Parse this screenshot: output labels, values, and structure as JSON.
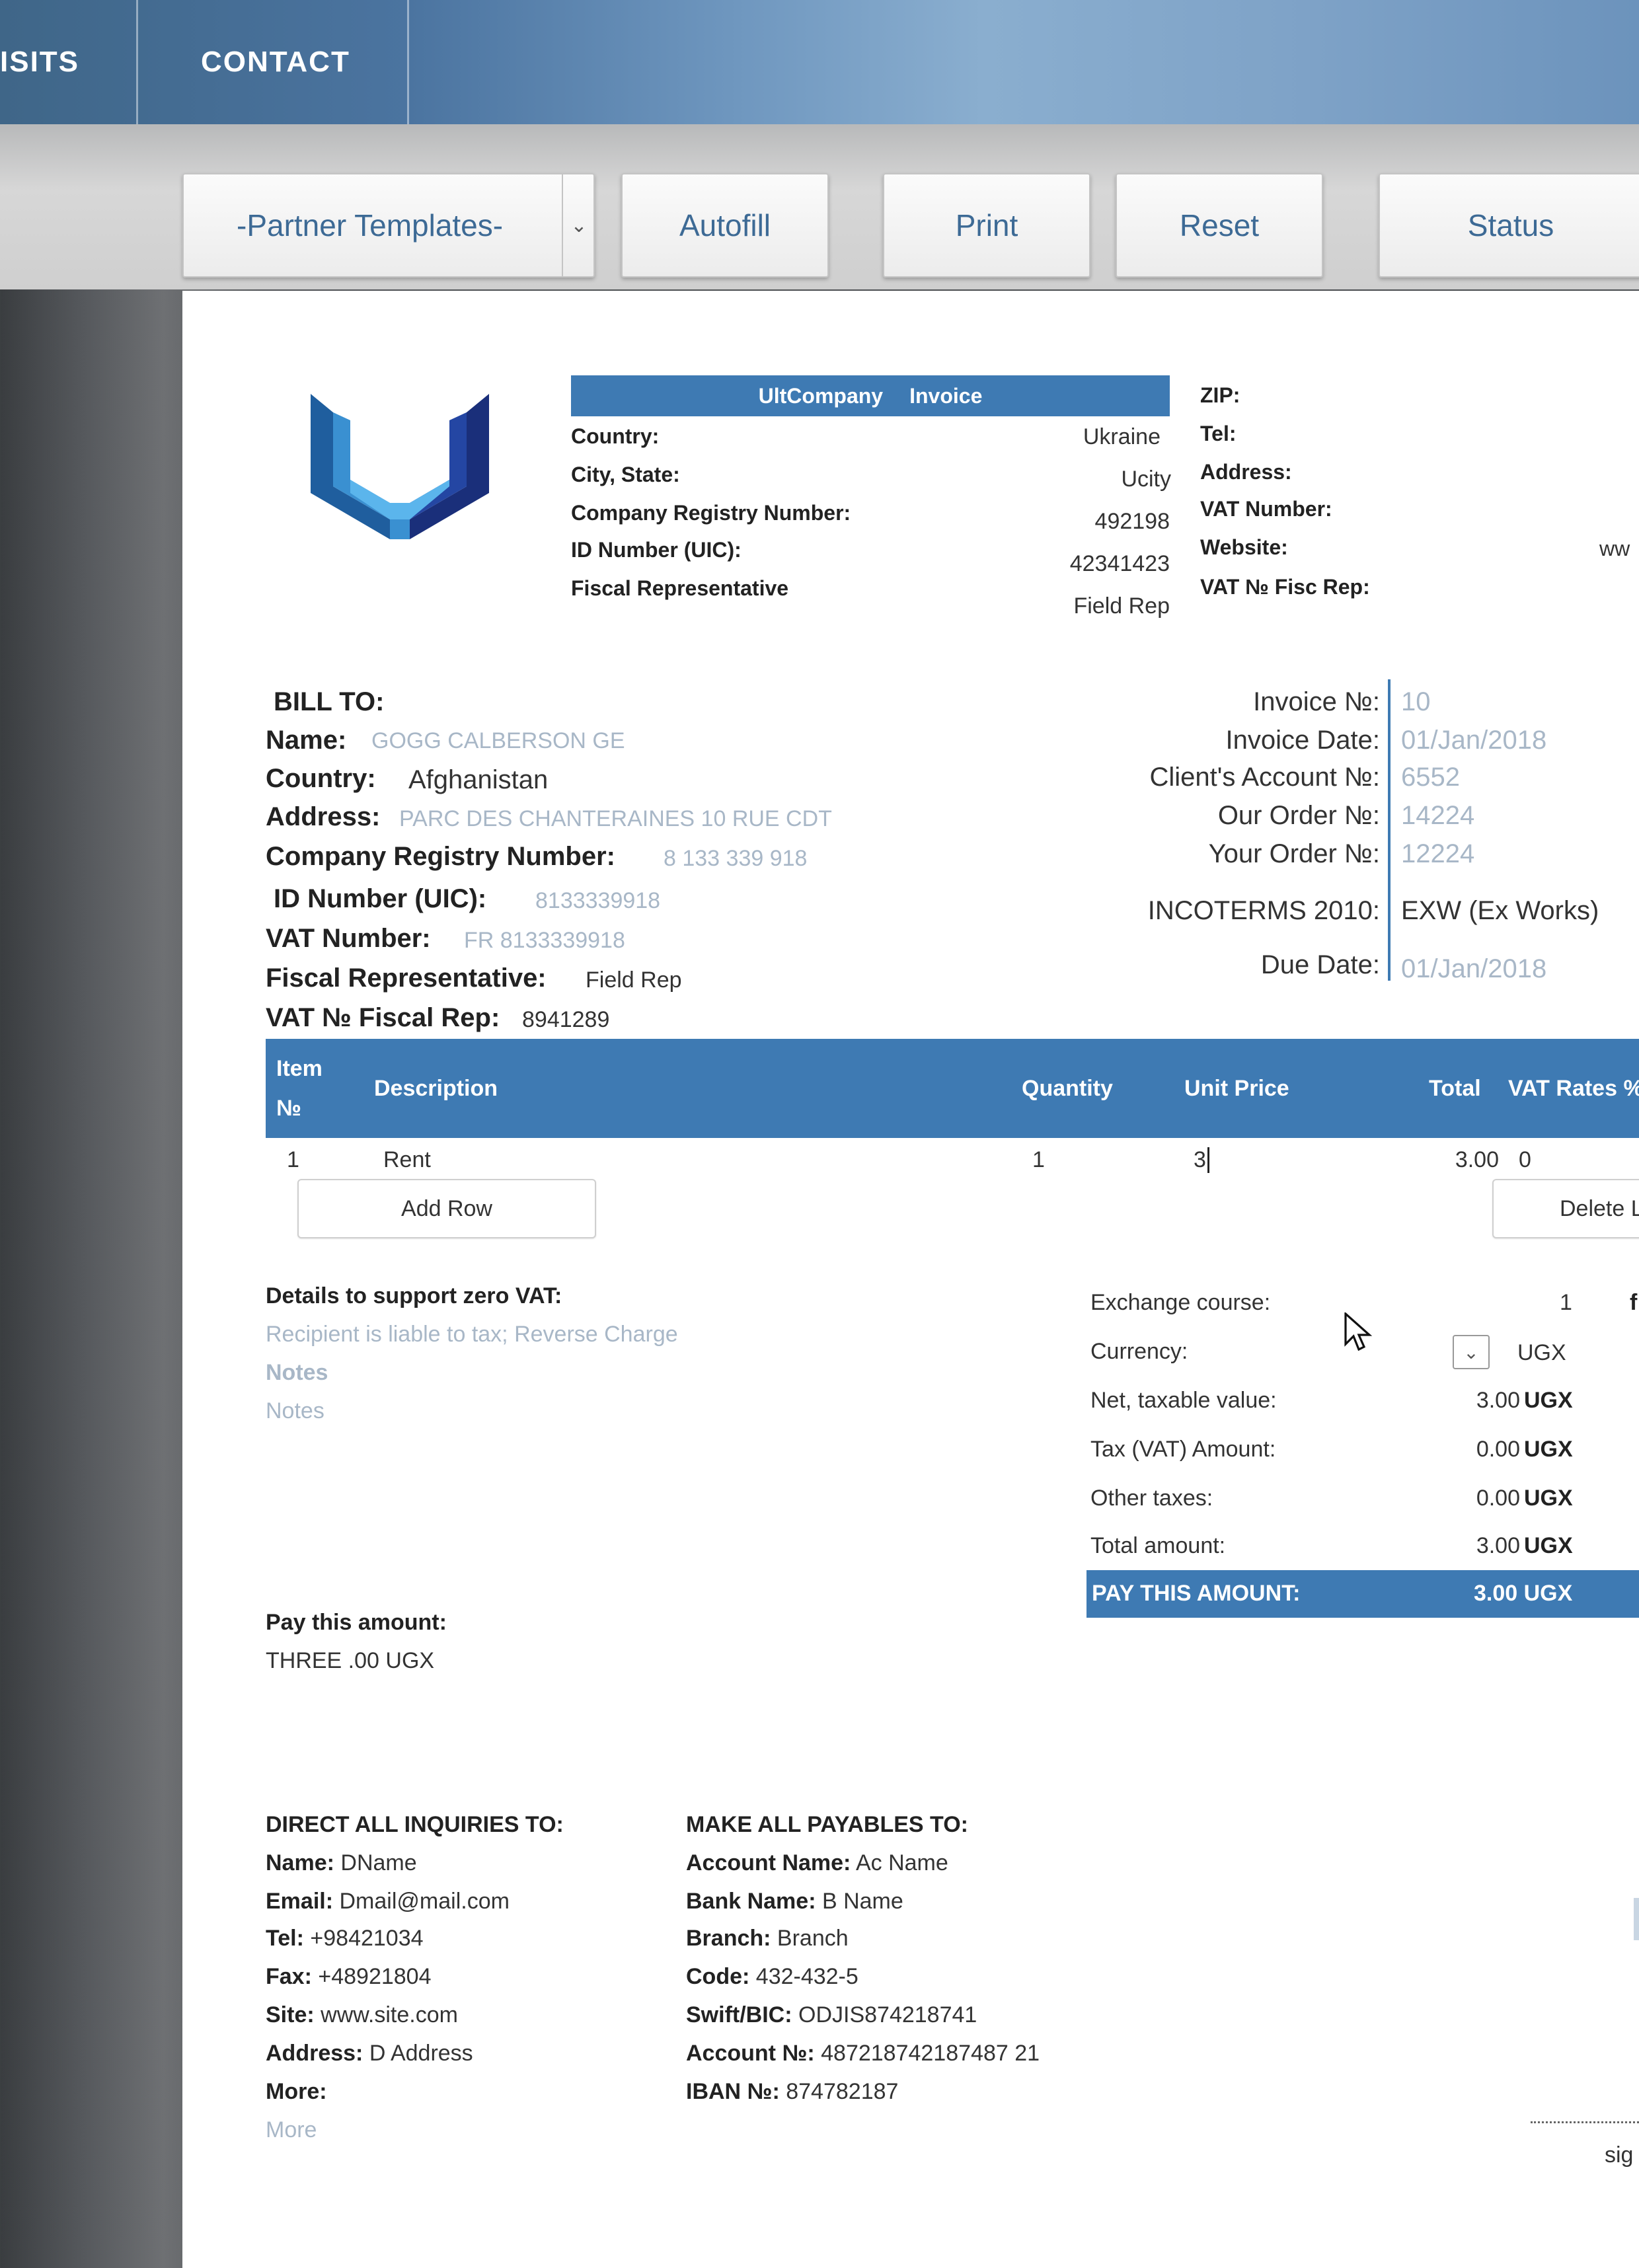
{
  "nav": {
    "items": [
      "ISITS",
      "CONTACT"
    ]
  },
  "toolbar": {
    "template_select": "-Partner Templates-",
    "autofill": "Autofill",
    "print": "Print",
    "reset": "Reset",
    "status": "Status"
  },
  "company": {
    "header_name": "UltCompany",
    "header_doc": "Invoice",
    "country_label": "Country:",
    "country": "Ukraine",
    "city_label": "City, State:",
    "city": "Ucity",
    "reg_label": "Company Registry Number:",
    "reg": "492198",
    "id_label": "ID Number (UIC):",
    "id": "42341423",
    "fiscal_label": "Fiscal Representative",
    "fiscal": "Field Rep",
    "zip_label": "ZIP:",
    "tel_label": "Tel:",
    "address_label": "Address:",
    "vat_label": "VAT Number:",
    "website_label": "Website:",
    "website": "ww",
    "vatfisc_label": "VAT № Fisc Rep:"
  },
  "billto": {
    "title": "BILL TO:",
    "name_label": "Name:",
    "name": "GOGG CALBERSON GE",
    "country_label": "Country:",
    "country": "Afghanistan",
    "address_label": "Address:",
    "address": "PARC DES CHANTERAINES 10 RUE CDT",
    "reg_label": "Company Registry Number:",
    "reg": "8 133 339 918",
    "id_label": "ID Number (UIC):",
    "id": "8133339918",
    "vat_label": "VAT Number:",
    "vat": "FR 8133339918",
    "fiscal_label": "Fiscal Representative:",
    "fiscal": "Field Rep",
    "vatfisc_label": "VAT № Fiscal Rep:",
    "vatfisc": "8941289"
  },
  "invoice": {
    "no_label": "Invoice №:",
    "no": "10",
    "date_label": "Invoice Date:",
    "date": "01/Jan/2018",
    "account_label": "Client's Account №:",
    "account": "6552",
    "our_order_label": "Our Order №:",
    "our_order": "14224",
    "your_order_label": "Your Order №:",
    "your_order": "12224",
    "incoterms_label": "INCOTERMS 2010:",
    "incoterms": "EXW (Ex Works)",
    "due_label": "Due Date:",
    "due": "01/Jan/2018"
  },
  "table": {
    "headers": {
      "item_1": "Item",
      "item_2": "№",
      "description": "Description",
      "quantity": "Quantity",
      "unit_price": "Unit Price",
      "total": "Total",
      "vat": "VAT Rates %"
    },
    "rows": [
      {
        "item": "1",
        "description": "Rent",
        "quantity": "1",
        "unit_price": "3",
        "total": "3.00",
        "vat": "0"
      }
    ],
    "add_row": "Add Row",
    "delete": "Delete L"
  },
  "zero_vat": {
    "title": "Details to support zero VAT:",
    "text": "Recipient is liable to tax; Reverse Charge",
    "notes_label": "Notes",
    "notes": "Notes"
  },
  "totals": {
    "exchange_label": "Exchange course:",
    "exchange": "1",
    "exchange_extra": "f",
    "currency_label": "Currency:",
    "currency": "UGX",
    "net_label": "Net, taxable value:",
    "net": "3.00",
    "net_cur": "UGX",
    "tax_label": "Tax (VAT) Amount:",
    "tax": "0.00",
    "tax_cur": "UGX",
    "other_label": "Other taxes:",
    "other": "0.00",
    "other_cur": "UGX",
    "total_label": "Total amount:",
    "total": "3.00",
    "total_cur": "UGX",
    "pay_label": "PAY THIS AMOUNT:",
    "pay": "3.00 UGX"
  },
  "pay_words": {
    "label": "Pay this amount:",
    "value": "THREE .00 UGX"
  },
  "inquiries": {
    "title": "DIRECT ALL INQUIRIES TO:",
    "name_label": "Name:",
    "name": "DName",
    "email_label": "Email:",
    "email": "Dmail@mail.com",
    "tel_label": "Tel:",
    "tel": "+98421034",
    "fax_label": "Fax:",
    "fax": "+48921804",
    "site_label": "Site:",
    "site": "www.site.com",
    "address_label": "Address:",
    "address": "D Address",
    "more_label": "More:",
    "more": "More"
  },
  "payables": {
    "title": "MAKE ALL PAYABLES TO:",
    "account_name_label": "Account Name:",
    "account_name": "Ac Name",
    "bank_label": "Bank Name:",
    "bank": "B Name",
    "branch_label": "Branch:",
    "branch": "Branch",
    "code_label": "Code:",
    "code": "432-432-5",
    "swift_label": "Swift/BIC:",
    "swift": "ODJIS874218741",
    "account_no_label": "Account №:",
    "account_no": "487218742187487 21",
    "iban_label": "IBAN №:",
    "iban": "874782187"
  },
  "signature": {
    "label": "sig"
  },
  "colors": {
    "accent": "#3e7ab3",
    "muted": "#a8b7c7"
  }
}
